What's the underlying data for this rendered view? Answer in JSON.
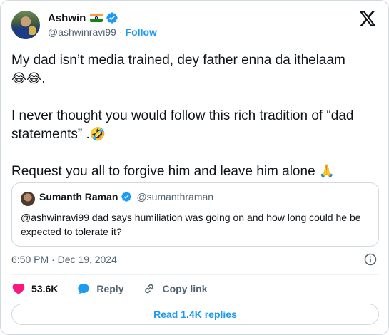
{
  "author": {
    "name": "Ashwin",
    "flag_emoji": "india-flag",
    "handle": "@ashwinravi99",
    "separator": "·",
    "follow_label": "Follow",
    "verified": true
  },
  "tweet": {
    "line1": "My dad isn’t media trained, dey father enna da ithelaam",
    "line1_emoji": "😂😂.",
    "line2": "I never thought you would follow this rich tradition of “dad statements” .",
    "line2_emoji": "🤣",
    "line3": "Request you all to forgive him and leave him alone",
    "line3_emoji": "🙏"
  },
  "quote": {
    "name": "Sumanth Raman",
    "handle": "@sumanthraman",
    "text": "@ashwinravi99 dad says humiliation was going on and how long could he be expected to tolerate it?"
  },
  "meta": {
    "time": "6:50 PM · Dec 19, 2024"
  },
  "actions": {
    "likes": "53.6K",
    "reply_label": "Reply",
    "copy_label": "Copy link"
  },
  "replies_button": "Read 1.4K replies",
  "colors": {
    "accent": "#1d9bf0",
    "like": "#f91880",
    "secondary_text": "#536471",
    "border": "#cfd9de"
  }
}
